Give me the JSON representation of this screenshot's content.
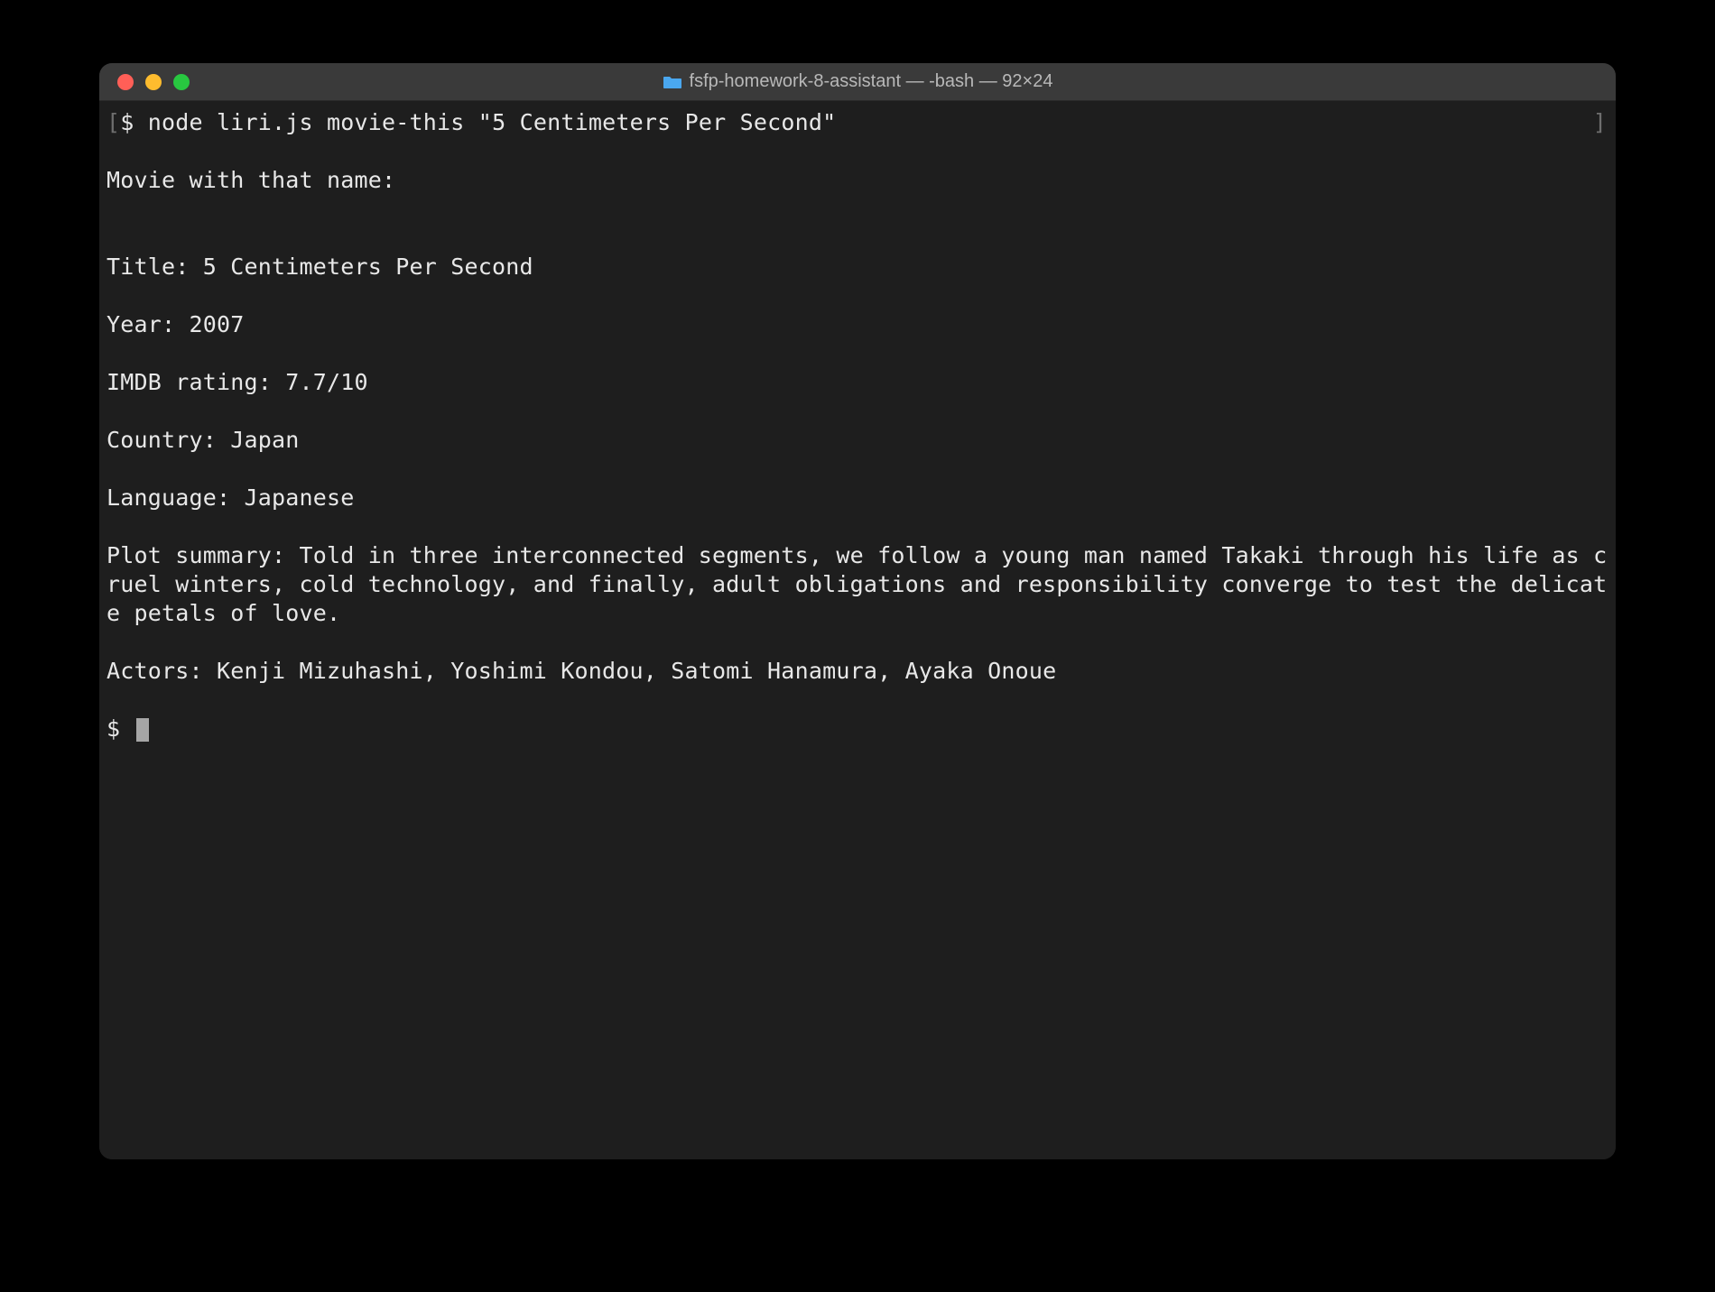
{
  "titlebar": {
    "title": "fsfp-homework-8-assistant — -bash — 92×24"
  },
  "terminal": {
    "left_bracket": "[",
    "right_bracket": "]",
    "prompt": "$ ",
    "command": "node liri.js movie-this \"5 Centimeters Per Second\"",
    "blank": "",
    "header_line": "Movie with that name:",
    "title_line": "Title: 5 Centimeters Per Second",
    "year_line": "Year: 2007",
    "imdb_line": "IMDB rating: 7.7/10",
    "country_line": "Country: Japan",
    "language_line": "Language: Japanese",
    "plot_line": "Plot summary: Told in three interconnected segments, we follow a young man named Takaki through his life as cruel winters, cold technology, and finally, adult obligations and responsibility converge to test the delicate petals of love.",
    "actors_line": "Actors: Kenji Mizuhashi, Yoshimi Kondou, Satomi Hanamura, Ayaka Onoue",
    "second_prompt": "$ "
  }
}
